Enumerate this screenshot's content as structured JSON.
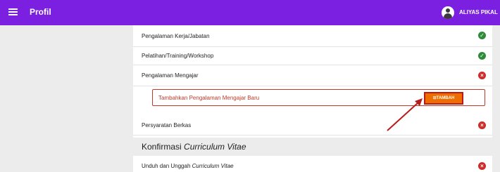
{
  "topbar": {
    "title": "Profil",
    "username": "ALIYAS PIKAL"
  },
  "rows": [
    {
      "label": "Pengalaman Kerja/Jabatan",
      "status": "ok"
    },
    {
      "label": "Pelatihan/Training/Workshop",
      "status": "ok"
    },
    {
      "label": "Pengalaman Mengajar",
      "status": "missing"
    },
    {
      "label": "Persyaratan Berkas",
      "status": "missing"
    }
  ],
  "add_teaching": {
    "label": "Tambahkan Pengalaman Mengajar Baru",
    "button_label": "TAMBAH"
  },
  "confirmation": {
    "title_prefix": "Konfirmasi ",
    "title_italic": "Curriculum Vitae",
    "upload_prefix": "Unduh dan Unggah ",
    "upload_italic": "Curriculum Vitae",
    "upload_status": "missing"
  },
  "icons": {
    "ok": "check-circle-icon",
    "missing": "x-circle-icon"
  },
  "colors": {
    "topbar": "#7b1fe0",
    "ok": "#2e8b3a",
    "missing": "#cf2b2b",
    "button": "#ef6c00",
    "arrow": "#b71c1c"
  }
}
